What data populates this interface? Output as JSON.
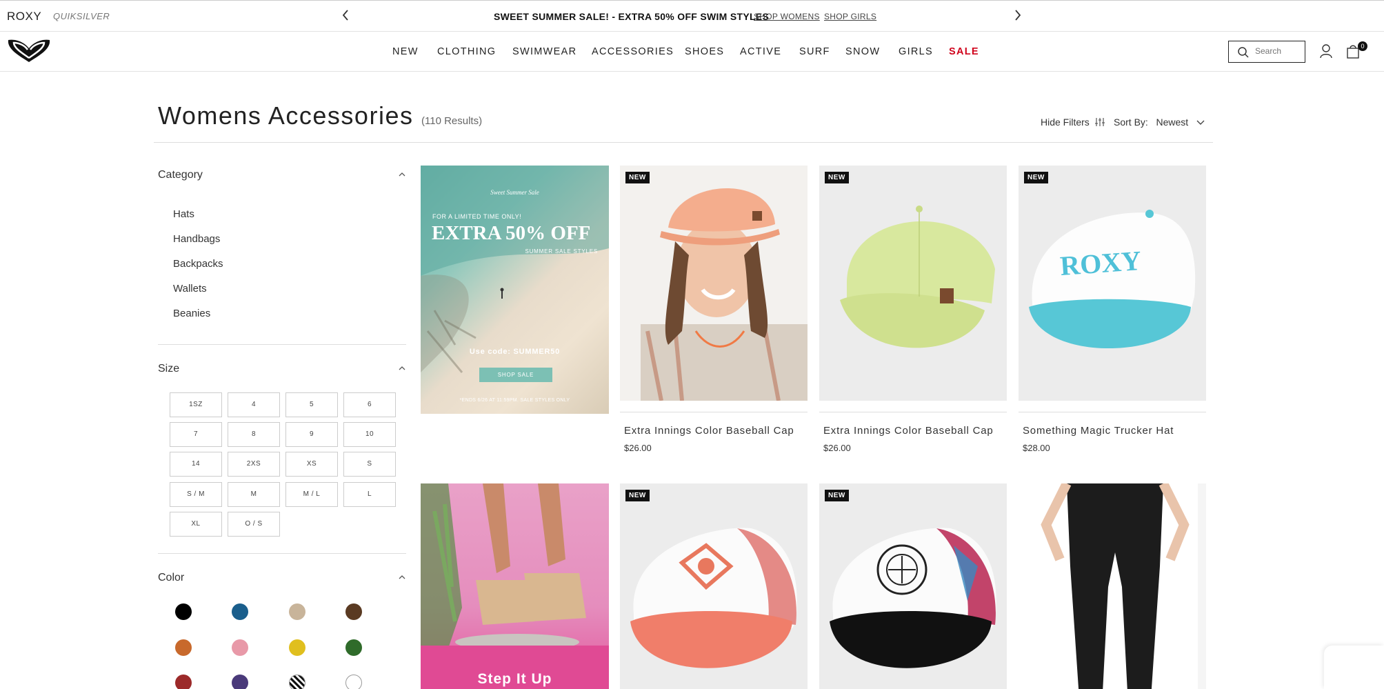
{
  "promo_bar": {
    "brand_primary": "ROXY",
    "brand_secondary": "QUIKSILVER",
    "message": "SWEET SUMMER SALE! - EXTRA 50% OFF SWIM STYLES",
    "link_women": "SHOP WOMENS",
    "link_girls": "SHOP GIRLS",
    "prev_icon": "chevron-left-icon",
    "next_icon": "chevron-right-icon"
  },
  "nav": {
    "items": [
      "NEW",
      "CLOTHING",
      "SWIMWEAR",
      "ACCESSORIES",
      "SHOES",
      "ACTIVE",
      "SURF",
      "SNOW",
      "GIRLS",
      "SALE"
    ],
    "sale_color": "#d0021b",
    "search_placeholder": "Search",
    "cart_count": "0"
  },
  "page": {
    "title": "Womens Accessories",
    "results": "(110 Results)",
    "hide_filters": "Hide Filters",
    "sort_label": "Sort By:",
    "sort_value": "Newest"
  },
  "filters": {
    "category": {
      "title": "Category",
      "items": [
        "Hats",
        "Handbags",
        "Backpacks",
        "Wallets",
        "Beanies"
      ]
    },
    "size": {
      "title": "Size",
      "options": [
        "1SZ",
        "4",
        "5",
        "6",
        "7",
        "8",
        "9",
        "10",
        "14",
        "2XS",
        "XS",
        "S",
        "S / M",
        "M",
        "M / L",
        "L",
        "XL",
        "O / S"
      ]
    },
    "color": {
      "title": "Color",
      "swatches": [
        "#000000",
        "#1a5e8c",
        "#c8b49a",
        "#5a3a22",
        "#c8692c",
        "#e899a8",
        "#e0bf1e",
        "#2f6b2a",
        "#9c2a2a",
        "#4a3a7a",
        "pattern-zebra",
        "#ffffff"
      ]
    }
  },
  "promo_tile": {
    "kicker": "Sweet Summer Sale",
    "limited": "FOR A LIMITED TIME ONLY!",
    "headline": "EXTRA 50% OFF",
    "sub": "SUMMER SALE STYLES",
    "code": "Use code: SUMMER50",
    "cta": "SHOP SALE",
    "fine_print": "*ENDS 6/26 AT 11:59PM. SALE STYLES ONLY"
  },
  "promo_tile_2": {
    "headline": "Step It Up"
  },
  "products": [
    {
      "name": "Extra Innings Color Baseball Cap",
      "price": "$26.00",
      "badge": "NEW"
    },
    {
      "name": "Extra Innings Color Baseball Cap",
      "price": "$26.00",
      "badge": "NEW"
    },
    {
      "name": "Something Magic Trucker Hat",
      "price": "$28.00",
      "badge": "NEW"
    },
    {
      "badge": "NEW"
    },
    {
      "badge": "NEW"
    },
    {}
  ]
}
